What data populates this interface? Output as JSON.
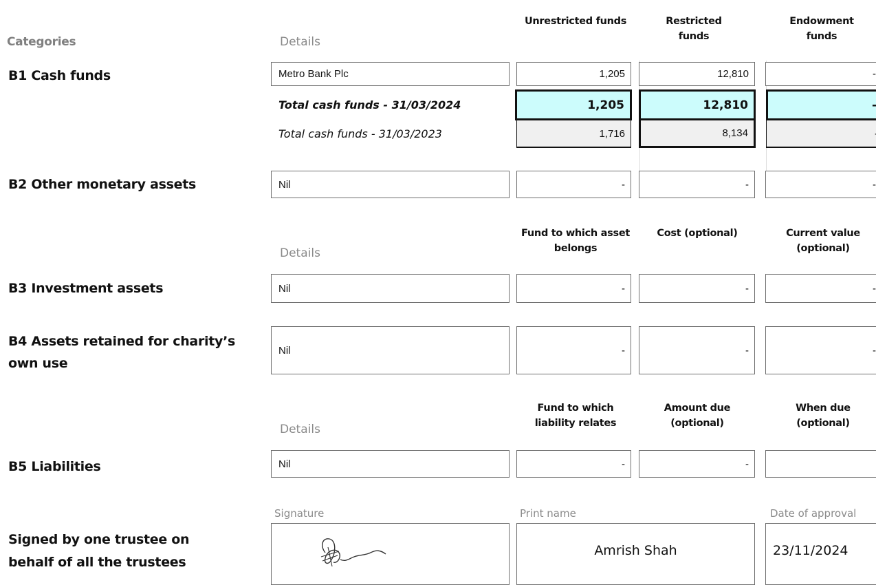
{
  "headers": {
    "categories": "Categories",
    "details": "Details",
    "col1": "Unrestricted funds",
    "col2": "Restricted funds",
    "col3": "Endowment funds"
  },
  "b1": {
    "label": "B1 Cash funds",
    "row1": {
      "detail": "Metro Bank Plc",
      "unrestricted": "1,205",
      "restricted": "12,810",
      "endowment": "-"
    },
    "total_current": {
      "label": "Total cash funds - 31/03/2024",
      "unrestricted": "1,205",
      "restricted": "12,810",
      "endowment": "-"
    },
    "total_prior": {
      "label": "Total cash funds - 31/03/2023",
      "unrestricted": "1,716",
      "restricted": "8,134",
      "endowment": "-"
    }
  },
  "b2": {
    "label": "B2 Other monetary assets",
    "detail": "Nil",
    "unrestricted": "-",
    "restricted": "-",
    "endowment": "-"
  },
  "assets_headers": {
    "details": "Details",
    "col1": "Fund to which asset belongs",
    "col2": "Cost (optional)",
    "col3": "Current value (optional)"
  },
  "b3": {
    "label": "B3 Investment assets",
    "detail": "Nil",
    "fund": "-",
    "cost": "-",
    "value": "-"
  },
  "b4": {
    "label_line1": "B4 Assets retained for charity’s",
    "label_line2": "own use",
    "detail": "Nil",
    "fund": "-",
    "cost": "-",
    "value": "-"
  },
  "liab_headers": {
    "details": "Details",
    "col1": "Fund to which liability relates",
    "col2": "Amount due (optional)",
    "col3": "When due (optional)"
  },
  "b5": {
    "label": "B5 Liabilities",
    "detail": "Nil",
    "fund": "-",
    "amount": "-",
    "when": ""
  },
  "signature": {
    "label_line1": "Signed by one trustee on",
    "label_line2": "behalf of all the trustees",
    "sig_label": "Signature",
    "name_label": "Print name",
    "date_label": "Date of approval",
    "name": "Amrish Shah",
    "date": "23/11/2024"
  }
}
